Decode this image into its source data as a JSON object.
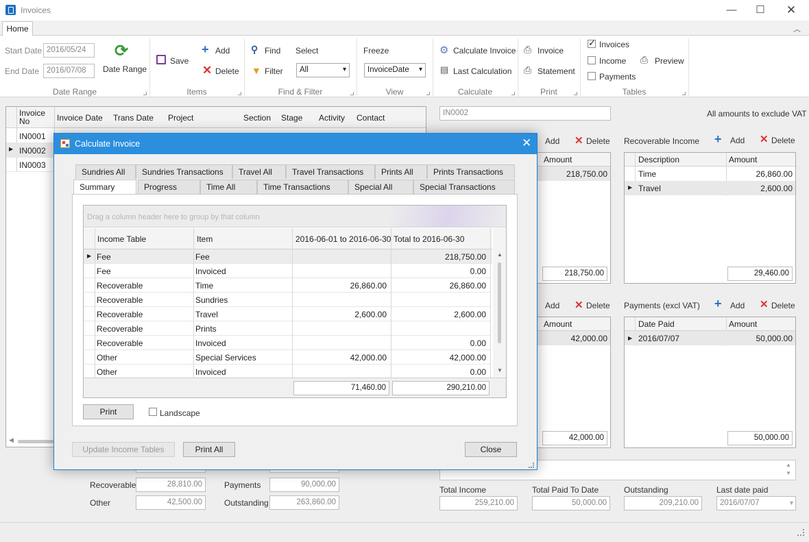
{
  "window": {
    "title": "Invoices"
  },
  "tab": "Home",
  "ribbon": {
    "start_label": "Start Date",
    "start_value": "2016/05/24",
    "end_label": "End Date",
    "end_value": "2016/07/08",
    "date_range_btn": "Date Range",
    "date_range_group": "Date Range",
    "save": "Save",
    "add": "Add",
    "delete": "Delete",
    "items_group": "Items",
    "find": "Find",
    "filter": "Filter",
    "select_label": "Select",
    "select_value": "All",
    "find_group": "Find & Filter",
    "freeze_label": "Freeze",
    "freeze_value": "InvoiceDate",
    "view_group": "View",
    "calc_invoice": "Calculate Invoice",
    "last_calc": "Last Calculation",
    "calc_group": "Calculate",
    "print_invoice": "Invoice",
    "print_statement": "Statement",
    "print_group": "Print",
    "t_invoices": "Invoices",
    "t_income": "Income",
    "t_payments": "Payments",
    "preview": "Preview",
    "tables_group": "Tables"
  },
  "invoice_grid": {
    "headers": [
      "Invoice No",
      "Invoice Date",
      "Trans Date",
      "Project",
      "Section",
      "Stage",
      "Activity",
      "Contact"
    ],
    "rows": [
      "IN0001",
      "IN0002",
      "IN0003"
    ]
  },
  "right": {
    "invoice_no": "IN0002",
    "vat_note": "All amounts to exclude VAT",
    "add": "Add",
    "delete": "Delete",
    "fee_header": "Amount",
    "fee_amount": "218,750.00",
    "fee_total": "218,750.00",
    "rec_title": "Recoverable Income",
    "rec_headers": [
      "Description",
      "Amount"
    ],
    "rec_rows": [
      {
        "d": "Time",
        "a": "26,860.00"
      },
      {
        "d": "Travel",
        "a": "2,600.00"
      }
    ],
    "rec_total": "29,460.00",
    "spec_header": "Amount",
    "spec_amount": "42,000.00",
    "spec_total": "42,000.00",
    "pay_title": "Payments (excl VAT)",
    "pay_headers": [
      "Date Paid",
      "Amount"
    ],
    "pay_rows": [
      {
        "d": "2016/07/07",
        "a": "50,000.00"
      }
    ],
    "pay_total": "50,000.00",
    "totals": {
      "income_label": "Total Income",
      "income": "259,210.00",
      "paid_label": "Total Paid To Date",
      "paid": "50,000.00",
      "out_label": "Outstanding",
      "out": "209,210.00",
      "last_label": "Last date paid",
      "last": "2016/07/07"
    }
  },
  "bottom_left": {
    "recoverable_label": "Recoverable",
    "recoverable": "28,810.00",
    "other_label": "Other",
    "other": "42,500.00",
    "payments_label": "Payments",
    "payments": "90,000.00",
    "outstanding_label": "Outstanding",
    "outstanding": "263,860.00"
  },
  "dialog": {
    "title": "Calculate Invoice",
    "tabs_back": [
      "Sundries All",
      "Sundries Transactions",
      "Travel All",
      "Travel Transactions",
      "Prints All",
      "Prints Transactions"
    ],
    "tabs_front": [
      "Summary",
      "Progress",
      "Time All",
      "Time Transactions",
      "Special All",
      "Special Transactions"
    ],
    "group_hint": "Drag a column header here to group by that column",
    "headers": [
      "Income Table",
      "Item",
      "2016-06-01 to 2016-06-30",
      "Total to 2016-06-30"
    ],
    "rows": [
      {
        "t": "Fee",
        "i": "Fee",
        "p": "",
        "tot": "218,750.00"
      },
      {
        "t": "Fee",
        "i": "Invoiced",
        "p": "",
        "tot": "0.00"
      },
      {
        "t": "Recoverable",
        "i": "Time",
        "p": "26,860.00",
        "tot": "26,860.00"
      },
      {
        "t": "Recoverable",
        "i": "Sundries",
        "p": "",
        "tot": ""
      },
      {
        "t": "Recoverable",
        "i": "Travel",
        "p": "2,600.00",
        "tot": "2,600.00"
      },
      {
        "t": "Recoverable",
        "i": "Prints",
        "p": "",
        "tot": ""
      },
      {
        "t": "Recoverable",
        "i": "Invoiced",
        "p": "",
        "tot": "0.00"
      },
      {
        "t": "Other",
        "i": "Special Services",
        "p": "42,000.00",
        "tot": "42,000.00"
      },
      {
        "t": "Other",
        "i": "Invoiced",
        "p": "",
        "tot": "0.00"
      }
    ],
    "sum_period": "71,460.00",
    "sum_total": "290,210.00",
    "print": "Print",
    "landscape": "Landscape",
    "update": "Update Income Tables",
    "print_all": "Print All",
    "close": "Close"
  }
}
